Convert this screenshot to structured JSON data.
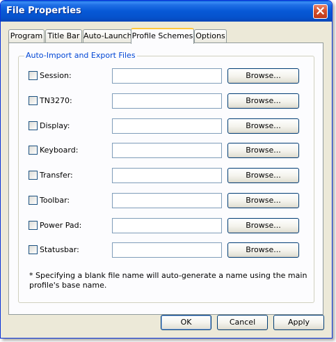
{
  "window": {
    "title": "File Properties"
  },
  "tabs": [
    {
      "label": "Program"
    },
    {
      "label": "Title Bar"
    },
    {
      "label": "Auto-Launch"
    },
    {
      "label": "Profile Schemes",
      "active": true
    },
    {
      "label": "Options"
    }
  ],
  "group": {
    "title": "Auto-Import and Export Files",
    "rows": [
      {
        "label": "Session:",
        "value": "",
        "checked": false
      },
      {
        "label": "TN3270:",
        "value": "",
        "checked": false
      },
      {
        "label": "Display:",
        "value": "",
        "checked": false
      },
      {
        "label": "Keyboard:",
        "value": "",
        "checked": false
      },
      {
        "label": "Transfer:",
        "value": "",
        "checked": false
      },
      {
        "label": "Toolbar:",
        "value": "",
        "checked": false
      },
      {
        "label": "Power Pad:",
        "value": "",
        "checked": false
      },
      {
        "label": "Statusbar:",
        "value": "",
        "checked": false
      }
    ],
    "browse_label": "Browse...",
    "note": "* Specifying a blank file name will auto-generate a name using the main profile's base name."
  },
  "footer": {
    "ok_label": "OK",
    "cancel_label": "Cancel",
    "apply_label": "Apply"
  },
  "colors": {
    "titlebar": "#0758d6",
    "group_title": "#0046d5",
    "close_button": "#d4502c",
    "active_tab_accent": "#ffc83c"
  },
  "icons": {
    "close": "close-icon"
  }
}
